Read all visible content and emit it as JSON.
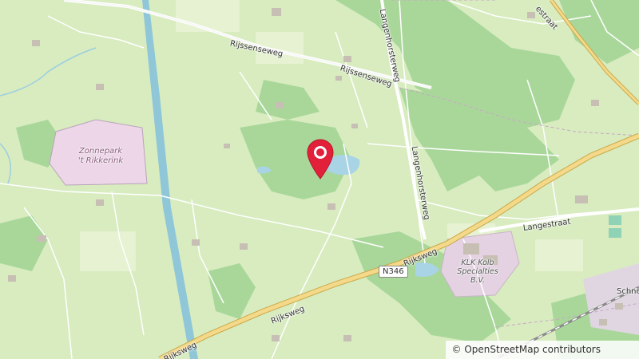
{
  "roads": {
    "rijssenseweg_west": "Rijssenseweg",
    "rijssenseweg_east": "Rijssenseweg",
    "langenhorsterweg_north": "Langenhorsterweg",
    "langenhorsterweg_south": "Langenhorsterweg",
    "rijksweg_east": "Rijksweg",
    "rijksweg_mid": "Rijksweg",
    "rijksweg_west": "Rijksweg",
    "langestraat": "Langestraat",
    "estraat": "estraat",
    "schnee": "Schnee"
  },
  "shield": {
    "label": "N346"
  },
  "areas": {
    "zonnepark_line1": "Zonnepark",
    "zonnepark_line2": "'t Rikkerink"
  },
  "business": {
    "line1": "KLK Kolb",
    "line2": "Specialties",
    "line3": "B.V."
  },
  "attribution": {
    "text": "© OpenStreetMap contributors"
  },
  "marker": {
    "color": "#e3203a",
    "icon": "map-pin-icon"
  },
  "colors": {
    "meadow": "#d8ecc0",
    "forest": "#a9d79a",
    "canal": "#8fc7d8",
    "water": "#a8d4e6",
    "major_road": "#f4d98a",
    "solar_park": "#ecd6e8",
    "industrial": "#e4d2e2"
  }
}
